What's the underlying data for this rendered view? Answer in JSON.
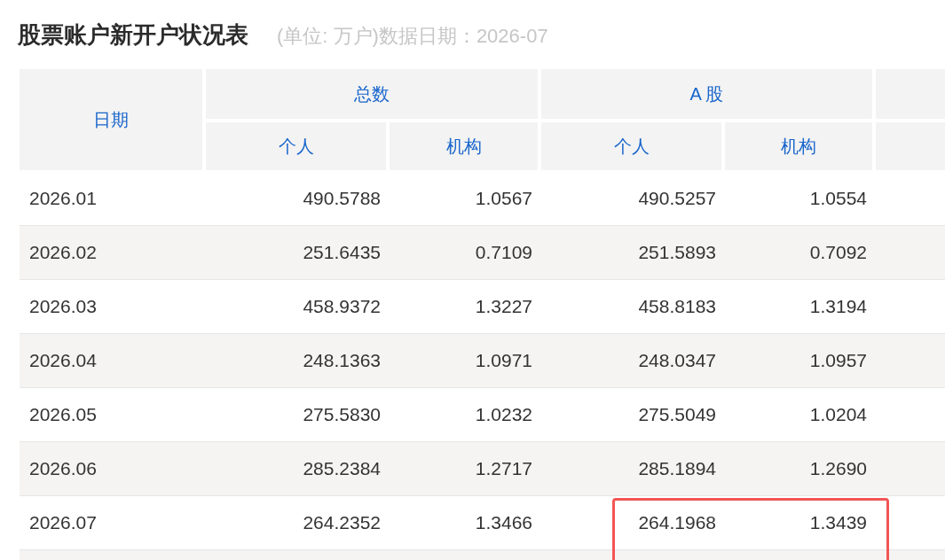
{
  "title": "股票账户新开户状况表",
  "subtitle": "(单位: 万户)数据日期：2026-07",
  "table": {
    "date_header": "日期",
    "groups": [
      {
        "label": "总数",
        "columns": [
          "个人",
          "机构"
        ]
      },
      {
        "label": "A 股",
        "columns": [
          "个人",
          "机构"
        ]
      }
    ],
    "rows": [
      {
        "date": "2026.01",
        "values": [
          "490.5788",
          "1.0567",
          "490.5257",
          "1.0554"
        ],
        "highlighted": false
      },
      {
        "date": "2026.02",
        "values": [
          "251.6435",
          "0.7109",
          "251.5893",
          "0.7092"
        ],
        "highlighted": false
      },
      {
        "date": "2026.03",
        "values": [
          "458.9372",
          "1.3227",
          "458.8183",
          "1.3194"
        ],
        "highlighted": false
      },
      {
        "date": "2026.04",
        "values": [
          "248.1363",
          "1.0971",
          "248.0347",
          "1.0957"
        ],
        "highlighted": false
      },
      {
        "date": "2026.05",
        "values": [
          "275.5830",
          "1.0232",
          "275.5049",
          "1.0204"
        ],
        "highlighted": false
      },
      {
        "date": "2026.06",
        "values": [
          "285.2384",
          "1.2717",
          "285.1894",
          "1.2690"
        ],
        "highlighted": false
      },
      {
        "date": "2026.07",
        "values": [
          "264.2352",
          "1.3466",
          "264.1968",
          "1.3439"
        ],
        "highlighted": true
      }
    ]
  }
}
